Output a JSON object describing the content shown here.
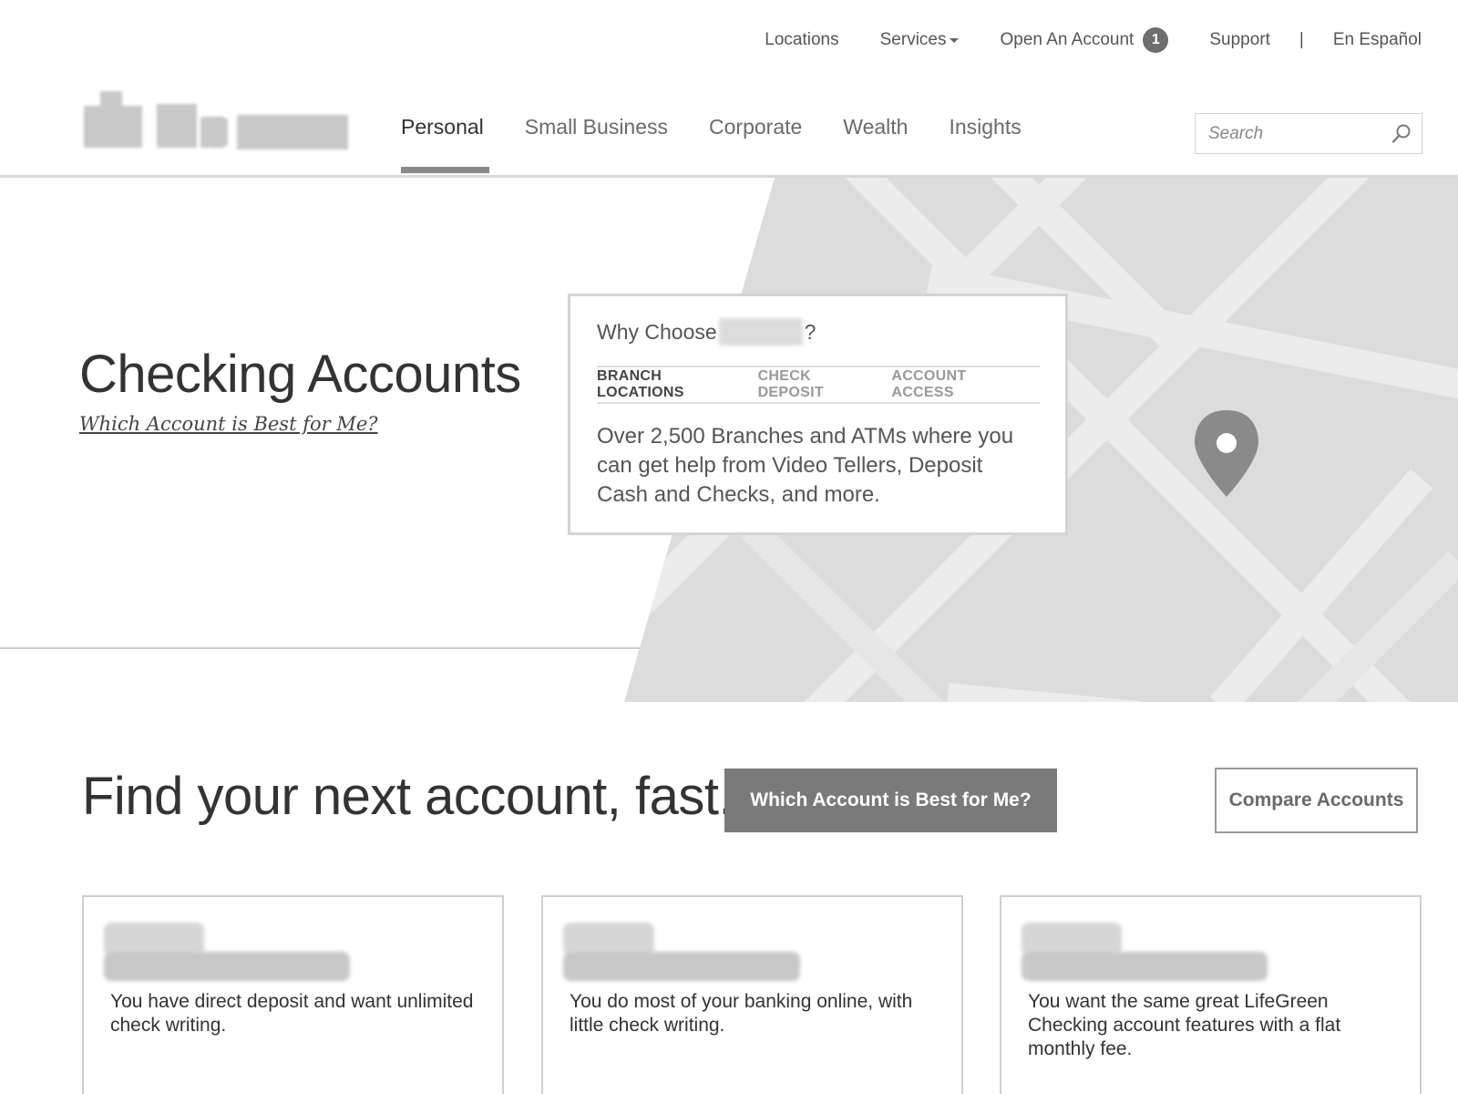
{
  "utility_nav": {
    "locations": "Locations",
    "services": "Services",
    "open_account": "Open An Account",
    "open_account_badge": "1",
    "support": "Support",
    "separator": "|",
    "language": "En Español"
  },
  "main_nav": {
    "items": [
      "Personal",
      "Small Business",
      "Corporate",
      "Wealth",
      "Insights"
    ],
    "active": "Personal"
  },
  "search": {
    "placeholder": "Search"
  },
  "hero": {
    "title": "Checking Accounts",
    "link": "Which Account is Best for Me?"
  },
  "why_card": {
    "title_prefix": "Why Choose",
    "title_suffix": "?",
    "tabs": [
      "BRANCH LOCATIONS",
      "CHECK DEPOSIT",
      "ACCOUNT ACCESS"
    ],
    "active_tab": "BRANCH LOCATIONS",
    "body": "Over 2,500 Branches and ATMs where you can get help from Video Tellers, Deposit Cash and Checks, and more."
  },
  "find": {
    "title": "Find your next account, fast.",
    "primary_button": "Which Account is Best for Me?",
    "secondary_button": "Compare Accounts"
  },
  "cards": [
    {
      "description": "You have direct deposit and want unlimited check writing."
    },
    {
      "description": "You do most of your banking online, with little check writing."
    },
    {
      "description": "You want the same great LifeGreen Checking account features with a flat monthly fee."
    }
  ],
  "icons": {
    "search": "search-icon",
    "map_pin": "map-pin-icon",
    "dropdown": "caret-down-icon"
  },
  "colors": {
    "map_background": "#dcdcdc",
    "map_roads": "#ececec",
    "pin": "#8a8a8a",
    "primary_button": "#7a7a7a",
    "badge": "#6e6e6e"
  }
}
